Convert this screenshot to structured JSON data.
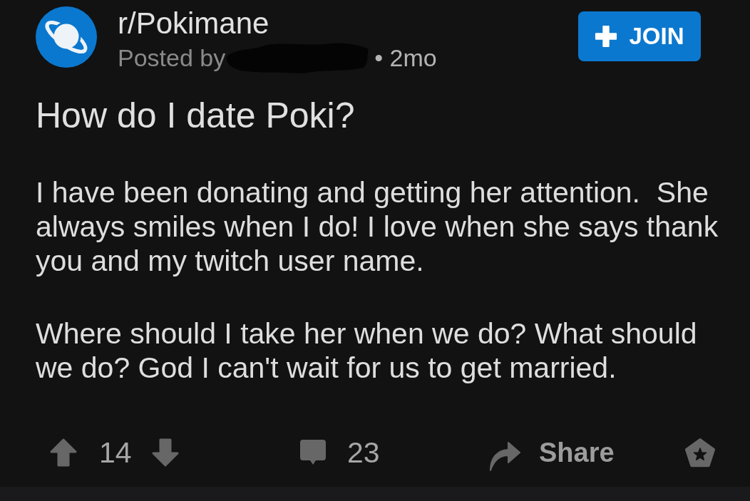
{
  "post": {
    "subreddit": "r/Pokimane",
    "posted_by_label": "Posted by",
    "age": "• 2mo",
    "join_button": {
      "label": "JOIN"
    },
    "title": "How do I date Poki?",
    "body": [
      "I have been donating and getting her attention.  She always smiles when I do! I love when she says thank you and my twitch user name.",
      "Where should I take her when we do? What should we do? God I can't wait for us to get married."
    ],
    "actions": {
      "score": "14",
      "comments": "23",
      "share": "Share"
    }
  }
}
